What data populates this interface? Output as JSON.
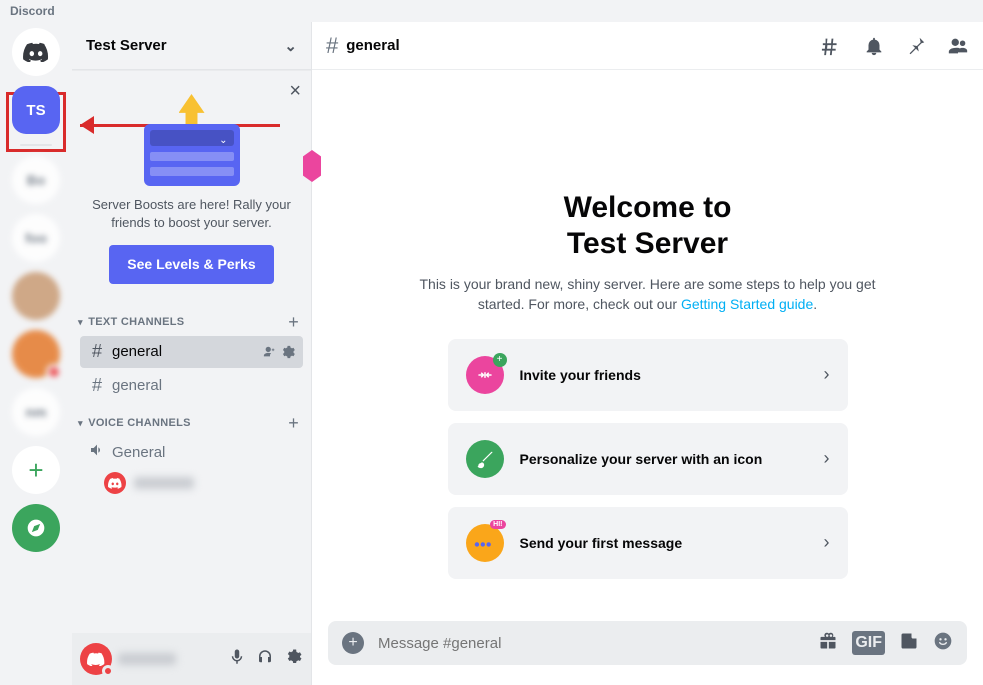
{
  "app_name": "Discord",
  "servers": {
    "active_initials": "TS",
    "add_label": "+"
  },
  "sidebar": {
    "server_name": "Test Server",
    "boost": {
      "text": "Server Boosts are here! Rally your friends to boost your server.",
      "button": "See Levels & Perks"
    },
    "text_category": "TEXT CHANNELS",
    "voice_category": "VOICE CHANNELS",
    "channels": {
      "general1": "general",
      "general2": "general",
      "voice_general": "General"
    }
  },
  "channel_bar": {
    "name": "general"
  },
  "welcome": {
    "line1": "Welcome to",
    "line2": "Test Server",
    "desc_prefix": "This is your brand new, shiny server. Here are some steps to help you get started. For more, check out our ",
    "desc_link": "Getting Started guide",
    "desc_suffix": "."
  },
  "steps": {
    "invite": "Invite your friends",
    "personalize": "Personalize your server with an icon",
    "first_msg": "Send your first message"
  },
  "composer": {
    "placeholder": "Message #general",
    "gif": "GIF"
  }
}
